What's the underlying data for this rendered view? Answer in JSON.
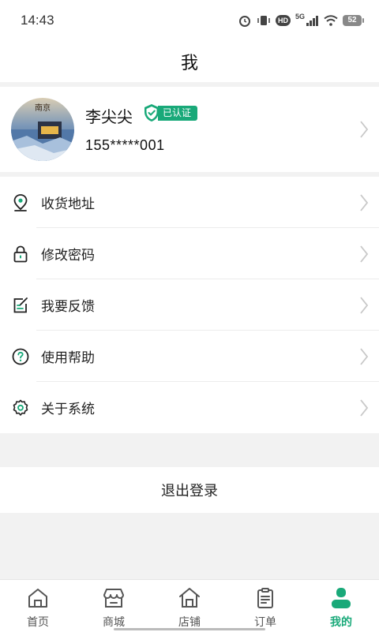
{
  "status_bar": {
    "time": "14:43",
    "network": "5G",
    "hd": "HD",
    "battery": "52"
  },
  "header": {
    "title": "我"
  },
  "profile": {
    "name": "李尖尖",
    "verified_label": "已认证",
    "phone": "155*****001",
    "avatar_caption": "南京"
  },
  "menu": {
    "items": [
      {
        "label": "收货地址",
        "icon": "location-pin-icon"
      },
      {
        "label": "修改密码",
        "icon": "lock-icon"
      },
      {
        "label": "我要反馈",
        "icon": "edit-note-icon"
      },
      {
        "label": "使用帮助",
        "icon": "help-icon"
      },
      {
        "label": "关于系统",
        "icon": "settings-gear-icon"
      }
    ]
  },
  "logout": {
    "label": "退出登录"
  },
  "bottom_nav": {
    "items": [
      {
        "label": "首页",
        "icon": "home-icon"
      },
      {
        "label": "商城",
        "icon": "store-icon"
      },
      {
        "label": "店铺",
        "icon": "shop-icon"
      },
      {
        "label": "订单",
        "icon": "order-icon"
      },
      {
        "label": "我的",
        "icon": "profile-icon"
      }
    ],
    "active_index": 4
  },
  "colors": {
    "accent": "#19a979",
    "background": "#f2f2f2"
  }
}
